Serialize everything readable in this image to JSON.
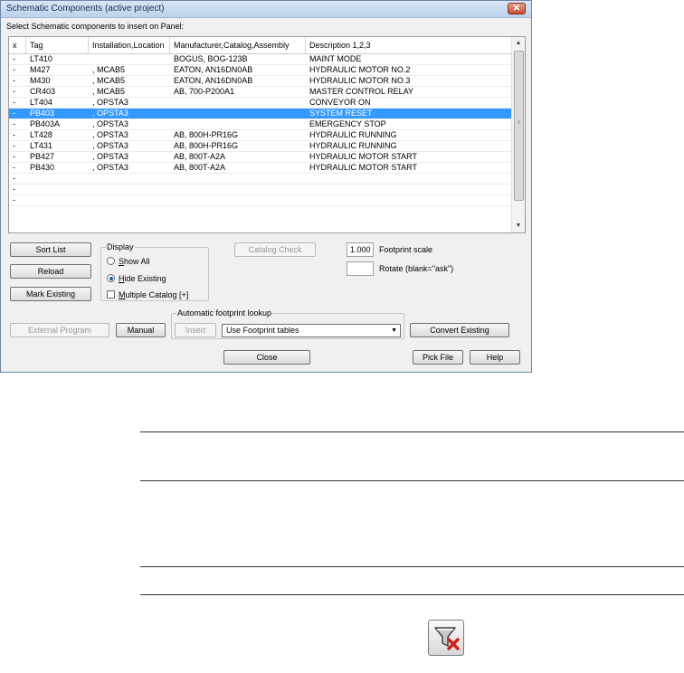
{
  "window": {
    "title": "Schematic Components (active project)",
    "close_glyph": "✕",
    "instruction": "Select Schematic components to insert on Panel:"
  },
  "table": {
    "columns": [
      "x",
      "Tag",
      "Installation,Location",
      "Manufacturer,Catalog,Assembly",
      "Description 1,2,3"
    ],
    "rows": [
      {
        "x": "-",
        "tag": "LT410",
        "loc": "",
        "mfr": "BOGUS, BOG-123B",
        "desc": "MAINT MODE"
      },
      {
        "x": "-",
        "tag": "M427",
        "loc": ", MCAB5",
        "mfr": "EATON, AN16DN0AB",
        "desc": "HYDRAULIC MOTOR NO.2"
      },
      {
        "x": "-",
        "tag": "M430",
        "loc": ", MCAB5",
        "mfr": "EATON, AN16DN0AB",
        "desc": "HYDRAULIC MOTOR NO.3"
      },
      {
        "x": "-",
        "tag": "CR403",
        "loc": ", MCAB5",
        "mfr": "AB, 700-P200A1",
        "desc": "MASTER CONTROL RELAY"
      },
      {
        "x": "-",
        "tag": "LT404",
        "loc": ", OPSTA3",
        "mfr": "",
        "desc": "CONVEYOR ON"
      },
      {
        "x": "-",
        "tag": "PB403",
        "loc": ", OPSTA3",
        "mfr": "",
        "desc": "SYSTEM RESET"
      },
      {
        "x": "-",
        "tag": "PB403A",
        "loc": ", OPSTA3",
        "mfr": "",
        "desc": "EMERGENCY STOP"
      },
      {
        "x": "-",
        "tag": "LT428",
        "loc": ", OPSTA3",
        "mfr": "AB, 800H-PR16G",
        "desc": "HYDRAULIC RUNNING"
      },
      {
        "x": "-",
        "tag": "LT431",
        "loc": ", OPSTA3",
        "mfr": "AB, 800H-PR16G",
        "desc": "HYDRAULIC RUNNING"
      },
      {
        "x": "-",
        "tag": "PB427",
        "loc": ", OPSTA3",
        "mfr": "AB, 800T-A2A",
        "desc": "HYDRAULIC MOTOR START"
      },
      {
        "x": "-",
        "tag": "PB430",
        "loc": ", OPSTA3",
        "mfr": "AB, 800T-A2A",
        "desc": "HYDRAULIC MOTOR START"
      },
      {
        "x": "-",
        "tag": "",
        "loc": "",
        "mfr": "",
        "desc": ""
      },
      {
        "x": "-",
        "tag": "",
        "loc": "",
        "mfr": "",
        "desc": ""
      },
      {
        "x": "-",
        "tag": "",
        "loc": "",
        "mfr": "",
        "desc": ""
      }
    ],
    "selected_row_tag": "PB403"
  },
  "buttons": {
    "sort_list": "Sort List",
    "reload": "Reload",
    "mark_existing": "Mark Existing",
    "catalog_check": "Catalog Check",
    "external_program": "External Program",
    "manual": "Manual",
    "insert": "Insert",
    "convert_existing": "Convert Existing",
    "close": "Close",
    "pick_file": "Pick File",
    "help": "Help"
  },
  "display": {
    "label": "Display",
    "show_all": "Show All",
    "hide_existing": "Hide Existing",
    "multiple_catalog": "Multiple Catalog [+]",
    "selected": "hide_existing",
    "multiple_catalog_checked": false
  },
  "footprint": {
    "scale_value": "1.000",
    "scale_label": "Footprint scale",
    "rotate_value": "",
    "rotate_label": "Rotate (blank=\"ask\")"
  },
  "lookup": {
    "label": "Automatic footprint lookup",
    "selected": "Use Footprint tables"
  },
  "icon": {
    "name": "filter-remove-icon"
  },
  "colors": {
    "selection": "#3399ff",
    "remove_x": "#d0201a"
  }
}
